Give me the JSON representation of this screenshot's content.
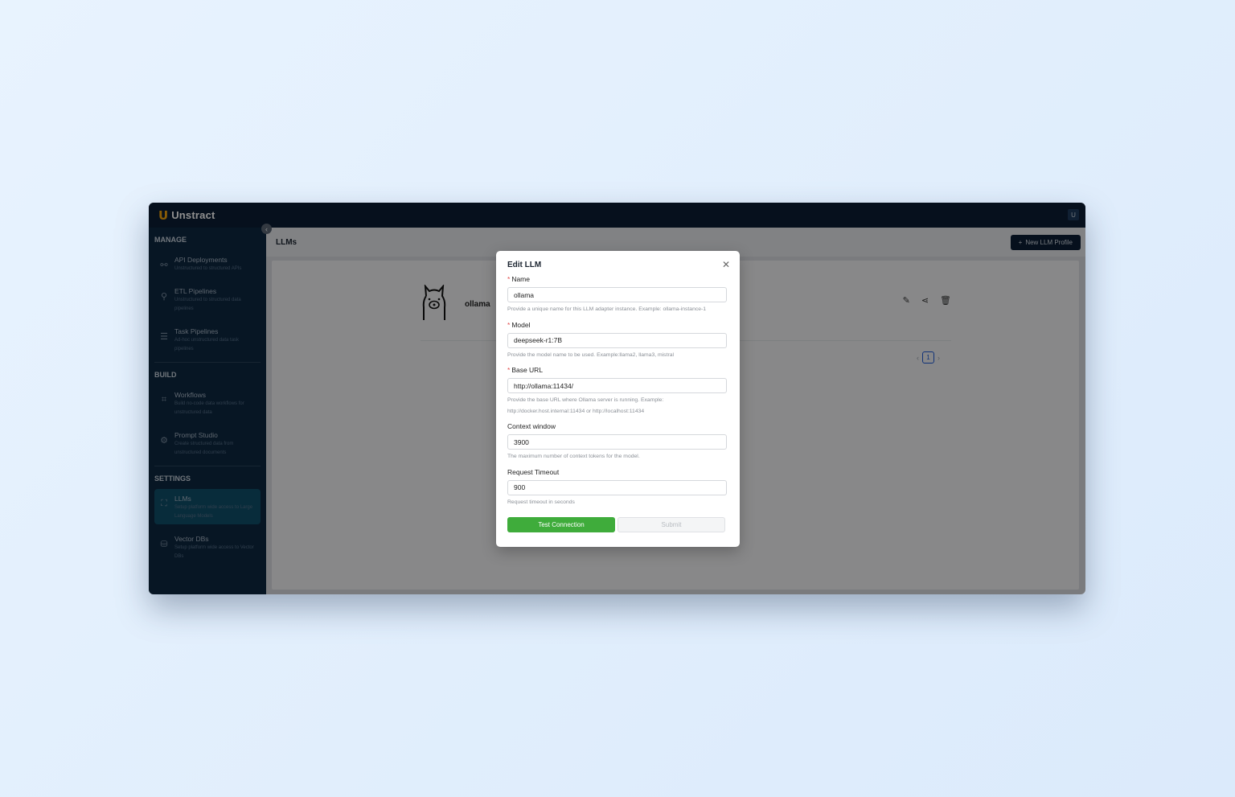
{
  "app": {
    "logo_text": "Unstract",
    "logo_mark": "U",
    "user_initial": "U"
  },
  "sidebar": {
    "sections": [
      {
        "label": "MANAGE",
        "items": [
          {
            "title": "API Deployments",
            "desc": "Unstructured to structured APIs",
            "icon": "api-icon"
          },
          {
            "title": "ETL Pipelines",
            "desc": "Unstructured to structured data pipelines",
            "icon": "etl-icon"
          },
          {
            "title": "Task Pipelines",
            "desc": "Ad-hoc unstructured data task pipelines",
            "icon": "task-icon"
          }
        ]
      },
      {
        "label": "BUILD",
        "items": [
          {
            "title": "Workflows",
            "desc": "Build no-code data workflows for unstructured data",
            "icon": "workflow-icon"
          },
          {
            "title": "Prompt Studio",
            "desc": "Create structured data from unstructured documents",
            "icon": "prompt-icon"
          }
        ]
      },
      {
        "label": "SETTINGS",
        "items": [
          {
            "title": "LLMs",
            "desc": "Setup platform wide access to Large Language Models",
            "icon": "llm-icon"
          },
          {
            "title": "Vector DBs",
            "desc": "Setup platform wide access to Vector DBs",
            "icon": "database-icon"
          }
        ]
      }
    ]
  },
  "header": {
    "title": "LLMs",
    "new_button": "New LLM Profile"
  },
  "list": {
    "items": [
      {
        "name": "ollama"
      }
    ],
    "page": "1"
  },
  "modal": {
    "title": "Edit LLM",
    "fields": [
      {
        "label": "Name",
        "required": true,
        "value": "ollama",
        "help": "Provide a unique name for this LLM adapter instance. Example: ollama-instance-1"
      },
      {
        "label": "Model",
        "required": true,
        "value": "deepseek-r1:7B",
        "help": "Provide the model name to be used. Example:llama2, llama3, mistral"
      },
      {
        "label": "Base URL",
        "required": true,
        "value": "http://ollama:11434/",
        "help_lines": [
          "Provide the base URL where Ollama server is running. Example:",
          "http://docker.host.internal:11434 or http://localhost:11434"
        ]
      },
      {
        "label": "Context window",
        "required": false,
        "value": "3900",
        "help": "The maximum number of context tokens for the model."
      },
      {
        "label": "Request Timeout",
        "required": false,
        "value": "900",
        "help": "Request timeout in seconds"
      }
    ],
    "test_button": "Test Connection",
    "submit_button": "Submit"
  },
  "colors": {
    "sidebar_bg": "#0e2841",
    "topbar_bg": "#0b1e34",
    "accent_green": "#3fac3b",
    "active_item": "#0f4f6a"
  }
}
